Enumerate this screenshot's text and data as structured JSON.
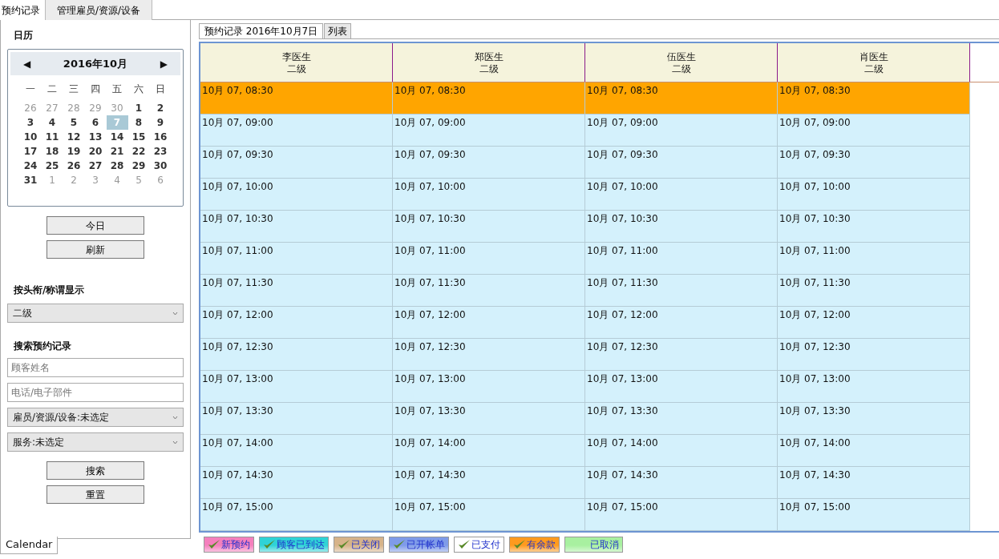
{
  "top_tabs": [
    {
      "label": "预约记录",
      "selected": true
    },
    {
      "label": "管理雇员/资源/设备",
      "selected": false
    }
  ],
  "sidebar": {
    "calendar_title": "日历",
    "calendar": {
      "month": "2016年10月",
      "prev": "◀",
      "next": "▶",
      "weekdays": [
        "一",
        "二",
        "三",
        "四",
        "五",
        "六",
        "日"
      ],
      "weeks": [
        [
          {
            "day": "26",
            "other_month": true,
            "selected": false
          },
          {
            "day": "27",
            "other_month": true,
            "selected": false
          },
          {
            "day": "28",
            "other_month": true,
            "selected": false
          },
          {
            "day": "29",
            "other_month": true,
            "selected": false
          },
          {
            "day": "30",
            "other_month": true,
            "selected": false
          },
          {
            "day": "1",
            "other_month": false,
            "selected": false
          },
          {
            "day": "2",
            "other_month": false,
            "selected": false
          }
        ],
        [
          {
            "day": "3",
            "other_month": false,
            "selected": false
          },
          {
            "day": "4",
            "other_month": false,
            "selected": false
          },
          {
            "day": "5",
            "other_month": false,
            "selected": false
          },
          {
            "day": "6",
            "other_month": false,
            "selected": false
          },
          {
            "day": "7",
            "other_month": false,
            "selected": true
          },
          {
            "day": "8",
            "other_month": false,
            "selected": false
          },
          {
            "day": "9",
            "other_month": false,
            "selected": false
          }
        ],
        [
          {
            "day": "10",
            "other_month": false,
            "selected": false
          },
          {
            "day": "11",
            "other_month": false,
            "selected": false
          },
          {
            "day": "12",
            "other_month": false,
            "selected": false
          },
          {
            "day": "13",
            "other_month": false,
            "selected": false
          },
          {
            "day": "14",
            "other_month": false,
            "selected": false
          },
          {
            "day": "15",
            "other_month": false,
            "selected": false
          },
          {
            "day": "16",
            "other_month": false,
            "selected": false
          }
        ],
        [
          {
            "day": "17",
            "other_month": false,
            "selected": false
          },
          {
            "day": "18",
            "other_month": false,
            "selected": false
          },
          {
            "day": "19",
            "other_month": false,
            "selected": false
          },
          {
            "day": "20",
            "other_month": false,
            "selected": false
          },
          {
            "day": "21",
            "other_month": false,
            "selected": false
          },
          {
            "day": "22",
            "other_month": false,
            "selected": false
          },
          {
            "day": "23",
            "other_month": false,
            "selected": false
          }
        ],
        [
          {
            "day": "24",
            "other_month": false,
            "selected": false
          },
          {
            "day": "25",
            "other_month": false,
            "selected": false
          },
          {
            "day": "26",
            "other_month": false,
            "selected": false
          },
          {
            "day": "27",
            "other_month": false,
            "selected": false
          },
          {
            "day": "28",
            "other_month": false,
            "selected": false
          },
          {
            "day": "29",
            "other_month": false,
            "selected": false
          },
          {
            "day": "30",
            "other_month": false,
            "selected": false
          }
        ],
        [
          {
            "day": "31",
            "other_month": false,
            "selected": false
          },
          {
            "day": "1",
            "other_month": true,
            "selected": false
          },
          {
            "day": "2",
            "other_month": true,
            "selected": false
          },
          {
            "day": "3",
            "other_month": true,
            "selected": false
          },
          {
            "day": "4",
            "other_month": true,
            "selected": false
          },
          {
            "day": "5",
            "other_month": true,
            "selected": false
          },
          {
            "day": "6",
            "other_month": true,
            "selected": false
          }
        ]
      ]
    },
    "calendar_buttons": [
      "今日",
      "刷新"
    ],
    "title_label": "按头衔/称谓显示",
    "title_select": "二级",
    "search_label": "搜索预约记录",
    "search_fields": [
      {
        "kind": "input",
        "placeholder": "顾客姓名"
      },
      {
        "kind": "input",
        "placeholder": "电话/电子部件"
      },
      {
        "kind": "select",
        "value": "雇员/资源/设备:未选定"
      },
      {
        "kind": "select",
        "value": "服务:未选定"
      }
    ],
    "search_buttons": [
      "搜索",
      "重置"
    ],
    "bottom_tab": "Calendar"
  },
  "view_tabs": [
    {
      "label": "预约记录 2016年10月7日",
      "selected": true
    },
    {
      "label": "列表",
      "selected": false
    }
  ],
  "schedule": {
    "columns": [
      {
        "name": "李医生",
        "title": "二级"
      },
      {
        "name": "郑医生",
        "title": "二级"
      },
      {
        "name": "伍医生",
        "title": "二级"
      },
      {
        "name": "肖医生",
        "title": "二级"
      }
    ],
    "rows": [
      {
        "color": "#ffa500",
        "cells": [
          "10月 07, 08:30",
          "10月 07, 08:30",
          "10月 07, 08:30",
          "10月 07, 08:30"
        ]
      },
      {
        "color": "#d4f1fc",
        "cells": [
          "10月 07, 09:00",
          "10月 07, 09:00",
          "10月 07, 09:00",
          "10月 07, 09:00"
        ]
      },
      {
        "color": "#d4f1fc",
        "cells": [
          "10月 07, 09:30",
          "10月 07, 09:30",
          "10月 07, 09:30",
          "10月 07, 09:30"
        ]
      },
      {
        "color": "#d4f1fc",
        "cells": [
          "10月 07, 10:00",
          "10月 07, 10:00",
          "10月 07, 10:00",
          "10月 07, 10:00"
        ]
      },
      {
        "color": "#d4f1fc",
        "cells": [
          "10月 07, 10:30",
          "10月 07, 10:30",
          "10月 07, 10:30",
          "10月 07, 10:30"
        ]
      },
      {
        "color": "#d4f1fc",
        "cells": [
          "10月 07, 11:00",
          "10月 07, 11:00",
          "10月 07, 11:00",
          "10月 07, 11:00"
        ]
      },
      {
        "color": "#d4f1fc",
        "cells": [
          "10月 07, 11:30",
          "10月 07, 11:30",
          "10月 07, 11:30",
          "10月 07, 11:30"
        ]
      },
      {
        "color": "#d4f1fc",
        "cells": [
          "10月 07, 12:00",
          "10月 07, 12:00",
          "10月 07, 12:00",
          "10月 07, 12:00"
        ]
      },
      {
        "color": "#d4f1fc",
        "cells": [
          "10月 07, 12:30",
          "10月 07, 12:30",
          "10月 07, 12:30",
          "10月 07, 12:30"
        ]
      },
      {
        "color": "#d4f1fc",
        "cells": [
          "10月 07, 13:00",
          "10月 07, 13:00",
          "10月 07, 13:00",
          "10月 07, 13:00"
        ]
      },
      {
        "color": "#d4f1fc",
        "cells": [
          "10月 07, 13:30",
          "10月 07, 13:30",
          "10月 07, 13:30",
          "10月 07, 13:30"
        ]
      },
      {
        "color": "#d4f1fc",
        "cells": [
          "10月 07, 14:00",
          "10月 07, 14:00",
          "10月 07, 14:00",
          "10月 07, 14:00"
        ]
      },
      {
        "color": "#d4f1fc",
        "cells": [
          "10月 07, 14:30",
          "10月 07, 14:30",
          "10月 07, 14:30",
          "10月 07, 14:30"
        ]
      },
      {
        "color": "#d4f1fc",
        "cells": [
          "10月 07, 15:00",
          "10月 07, 15:00",
          "10月 07, 15:00",
          "10月 07, 15:00"
        ]
      }
    ]
  },
  "legend": [
    {
      "label": "新预约",
      "color": "#f47fbd",
      "checked": true
    },
    {
      "label": "顾客已到达",
      "color": "#2fd3d6",
      "checked": true
    },
    {
      "label": "已关闭",
      "color": "#d6b38a",
      "checked": true
    },
    {
      "label": "已开帐单",
      "color": "#7f9be8",
      "checked": true
    },
    {
      "label": "已支付",
      "color": "#ffffff",
      "checked": true
    },
    {
      "label": "有余款",
      "color": "#ff9a1e",
      "checked": true
    },
    {
      "label": "已取消",
      "color": "#a8f0a0",
      "checked": false
    }
  ]
}
